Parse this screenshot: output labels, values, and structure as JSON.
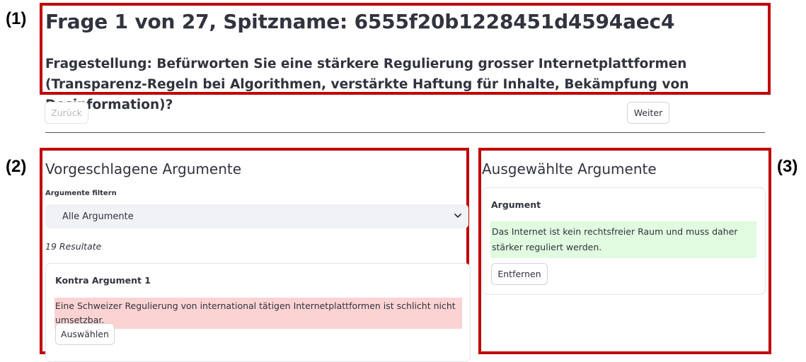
{
  "annotations": [
    "(1)",
    "(2)",
    "(3)"
  ],
  "header": {
    "title": "Frage 1 von 27, Spitzname: 6555f20b1228451d4594aec4",
    "question": "Fragestellung: Befürworten Sie eine stärkere Regulierung grosser Internetplattformen (Transparenz-Regeln bei Algorithmen, verstärkte Haftung für Inhalte, Bekämpfung von Desinformation)?"
  },
  "nav": {
    "back_label": "Zurück",
    "next_label": "Weiter"
  },
  "suggested": {
    "heading": "Vorgeschlagene Argumente",
    "filter_label": "Argumente filtern",
    "filter_value": "Alle Argumente",
    "results": "19 Resultate",
    "card": {
      "title": "Kontra Argument 1",
      "text": "Eine Schweizer Regulierung von international tätigen Internetplattformen ist schlicht nicht umsetzbar.",
      "select_label": "Auswählen"
    }
  },
  "selected": {
    "heading": "Ausgewählte Argumente",
    "card": {
      "title": "Argument",
      "text": "Das Internet ist kein rechtsfreier Raum und muss daher stärker reguliert werden.",
      "remove_label": "Entfernen"
    }
  },
  "colors": {
    "annotation_border": "#c00000",
    "contra_highlight": "#fbd3d2",
    "selected_highlight": "#e0fbdf"
  },
  "icons": {
    "dropdown": "chevron-down-icon"
  }
}
